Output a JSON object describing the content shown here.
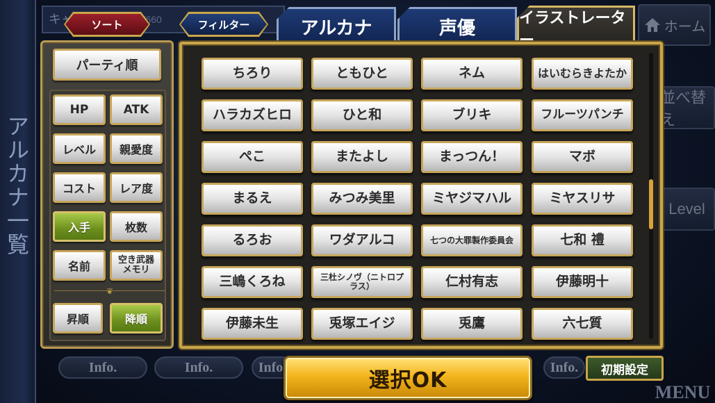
{
  "background": {
    "screen_title": "アルカナ一覧",
    "topbar_text": "キャ",
    "count_text": "57/660",
    "home_label": "ホーム",
    "side_labels": [
      "並べ替え",
      "Level"
    ],
    "info_label": "Info.",
    "menu_label": "MENU"
  },
  "sort_filter_tabs": {
    "sort": "ソート",
    "filter": "フィルター"
  },
  "sort_panel": {
    "party_order": "パーティ順",
    "options": [
      "HP",
      "ATK",
      "レベル",
      "親愛度",
      "コスト",
      "レア度",
      "入手",
      "枚数",
      "名前",
      "空き武器\nメモリ"
    ],
    "selected_option": "入手",
    "ascending": "昇順",
    "descending": "降順",
    "selected_direction": "降順"
  },
  "category_tabs": [
    "アルカナ",
    "声優",
    "イラストレーター"
  ],
  "active_category": "イラストレーター",
  "illustrators": [
    "ちろり",
    "ともひと",
    "ネム",
    "はいむらきよたか",
    "ハラカズヒロ",
    "ひと和",
    "ブリキ",
    "フルーツパンチ",
    "ぺこ",
    "またよし",
    "まっつん！",
    "マボ",
    "まるえ",
    "みつみ美里",
    "ミヤジマハル",
    "ミヤスリサ",
    "るろお",
    "ワダアルコ",
    "七つの大罪製作委員会",
    "七和 禮",
    "三嶋くろね",
    "三杜シノヴ（ニトロプラス）",
    "仁村有志",
    "伊藤明十",
    "伊藤未生",
    "兎塚エイジ",
    "兎鷹",
    "六七質"
  ],
  "buttons": {
    "ok": "選択OK",
    "reset": "初期設定"
  },
  "colors": {
    "gold": "#c9a64a",
    "selected_green": "#7a9c22",
    "ok_yellow": "#f3b51c",
    "sort_red": "#9b1f2a",
    "filter_blue": "#22407a"
  }
}
